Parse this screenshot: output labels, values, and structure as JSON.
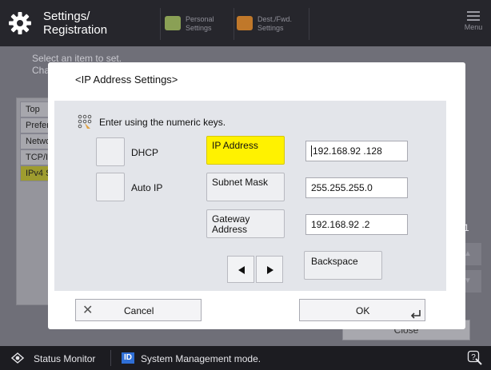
{
  "header": {
    "title_line1": "Settings/",
    "title_line2": "Registration",
    "tabs": [
      {
        "line1": "Personal",
        "line2": "Settings",
        "icon": "personal-settings-icon",
        "color": "#8aa055"
      },
      {
        "line1": "Dest./Fwd.",
        "line2": "Settings",
        "icon": "destination-icon",
        "color": "#c0782a"
      }
    ],
    "menu_label": "Menu"
  },
  "background_screen": {
    "instruction_line1": "Select an item to set.",
    "instruction_line2": "Cha",
    "items": [
      "Top",
      "Prefer",
      "Netwo",
      "TCP/IP",
      "IPv4 S"
    ],
    "page_indicator": "1/1",
    "close_label": "Close"
  },
  "dialog": {
    "title": "<IP Address Settings>",
    "instruction": "Enter using the numeric keys.",
    "dhcp_label": "DHCP",
    "autoip_label": "Auto IP",
    "fields": [
      {
        "label_line1": "IP Address",
        "label_line2": "",
        "value": "192.168.92 .128",
        "active": true
      },
      {
        "label_line1": "Subnet Mask",
        "label_line2": "",
        "value": "255.255.255.0",
        "active": false
      },
      {
        "label_line1": "Gateway",
        "label_line2": "Address",
        "value": "192.168.92 .2",
        "active": false
      }
    ],
    "backspace_label": "Backspace",
    "cancel_label": "Cancel",
    "ok_label": "OK"
  },
  "statusbar": {
    "status_label": "Status Monitor",
    "id_badge": "ID",
    "mode_label": "System Management mode."
  },
  "colors": {
    "accent_yellow": "#fff200",
    "id_blue": "#2f6fd6"
  }
}
